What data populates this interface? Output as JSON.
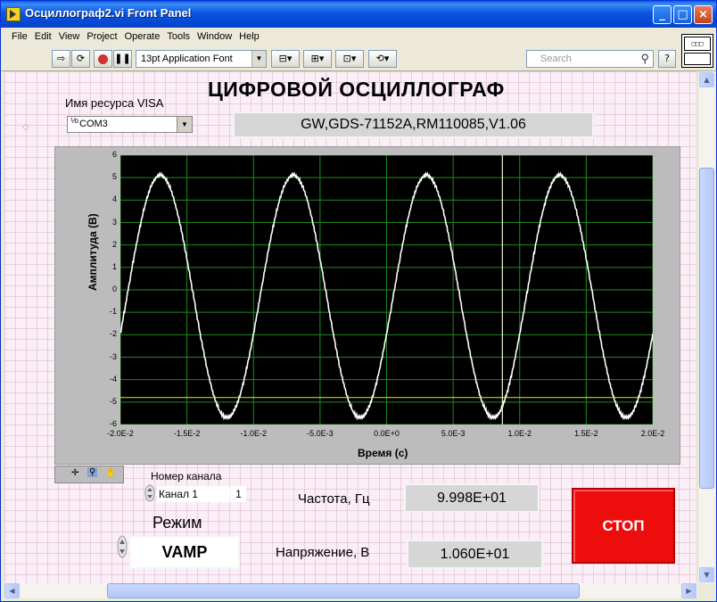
{
  "window": {
    "title": "Осциллограф2.vi Front Panel"
  },
  "menu": [
    "File",
    "Edit",
    "View",
    "Project",
    "Operate",
    "Tools",
    "Window",
    "Help"
  ],
  "toolbar": {
    "font": "13pt Application Font",
    "search_placeholder": "Search",
    "help": "?"
  },
  "panel": {
    "title": "ЦИФРОВОЙ ОСЦИЛЛОГРАФ",
    "visa_label": "Имя ресурса VISA",
    "visa_value": "COM3",
    "visa_io": "I/O",
    "device_id": "GW,GDS-71152A,RM110085,V1.06",
    "channel_label": "Номер канала",
    "channel_value": "Канал 1",
    "channel_number": "1",
    "mode_label": "Режим",
    "mode_value": "VAMP",
    "freq_label": "Частота, Гц",
    "freq_value": "9.998E+01",
    "volt_label": "Напряжение, В",
    "volt_value": "1.060E+01",
    "stop_label": "СТОП"
  },
  "chart_data": {
    "type": "line",
    "xlabel": "Время (с)",
    "ylabel": "Амплитуда (В)",
    "xlim": [
      -0.02,
      0.02
    ],
    "ylim": [
      -6,
      6
    ],
    "x_ticks": [
      "-2.0E-2",
      "-1.5E-2",
      "-1.0E-2",
      "-5.0E-3",
      "0.0E+0",
      "5.0E-3",
      "1.0E-2",
      "1.5E-2",
      "2.0E-2"
    ],
    "y_ticks": [
      "6",
      "5",
      "4",
      "3",
      "2",
      "1",
      "0",
      "-1",
      "-2",
      "-3",
      "-4",
      "-5",
      "-6"
    ],
    "grid": true,
    "background": "#000000",
    "series": [
      {
        "color": "#ffffff",
        "frequency_hz": 99.98,
        "amplitude": 5.4,
        "offset": -0.3,
        "phase_zero_cross_x": 0.0005
      }
    ],
    "cursors": {
      "vertical_x": 0.0087,
      "horizontal_y": -4.8,
      "color": "#e8e82a"
    }
  },
  "colors": {
    "panel_bg": "#fbeef6",
    "stop_button": "#ee0d0d",
    "plot_grid": "#1f8a1f"
  }
}
